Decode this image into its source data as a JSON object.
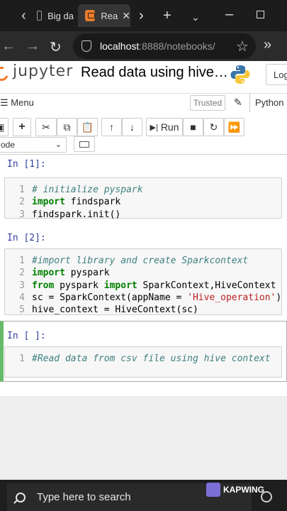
{
  "browser": {
    "tabs": [
      {
        "label": "Big da",
        "active": false
      },
      {
        "label": "Rea",
        "active": true
      }
    ],
    "new_tab": "+",
    "url_host": "localhost",
    "url_rest": ":8888/notebooks/"
  },
  "jupyter": {
    "logo_text": "jupyter",
    "notebook_title": "Read data using hive…",
    "logout_label": "Log",
    "menu_label": "Menu",
    "trusted_label": "Trusted",
    "kernel_name": "Python",
    "run_label": "Run",
    "cell_type": "ode"
  },
  "cells": [
    {
      "prompt": "In [1]:",
      "lines": [
        {
          "n": "1",
          "parts": [
            [
              "cm",
              "# initialize pyspark"
            ]
          ]
        },
        {
          "n": "2",
          "parts": [
            [
              "kw",
              "import"
            ],
            [
              "",
              " findspark"
            ]
          ]
        },
        {
          "n": "3",
          "parts": [
            [
              "",
              "findspark.init()"
            ]
          ]
        }
      ]
    },
    {
      "prompt": "In [2]:",
      "lines": [
        {
          "n": "1",
          "parts": [
            [
              "cm",
              "#import library and create Sparkcontext"
            ]
          ]
        },
        {
          "n": "2",
          "parts": [
            [
              "kw",
              "import"
            ],
            [
              "",
              " pyspark"
            ]
          ]
        },
        {
          "n": "3",
          "parts": [
            [
              "kw",
              "from"
            ],
            [
              "",
              " pyspark "
            ],
            [
              "kw",
              "import"
            ],
            [
              "",
              " SparkContext,HiveContext"
            ]
          ]
        },
        {
          "n": "4",
          "parts": [
            [
              "",
              "sc = SparkContext(appName = "
            ],
            [
              "st",
              "'Hive_operation'"
            ],
            [
              "",
              ")"
            ]
          ]
        },
        {
          "n": "5",
          "parts": [
            [
              "",
              "hive_context = HiveContext(sc)"
            ]
          ]
        }
      ]
    },
    {
      "prompt": "In [ ]:",
      "lines": [
        {
          "n": "1",
          "parts": [
            [
              "cm",
              "#Read data from csv file using hive context"
            ]
          ]
        }
      ]
    }
  ],
  "taskbar": {
    "search_placeholder": "Type here to search",
    "watermark": "KAPWING"
  }
}
